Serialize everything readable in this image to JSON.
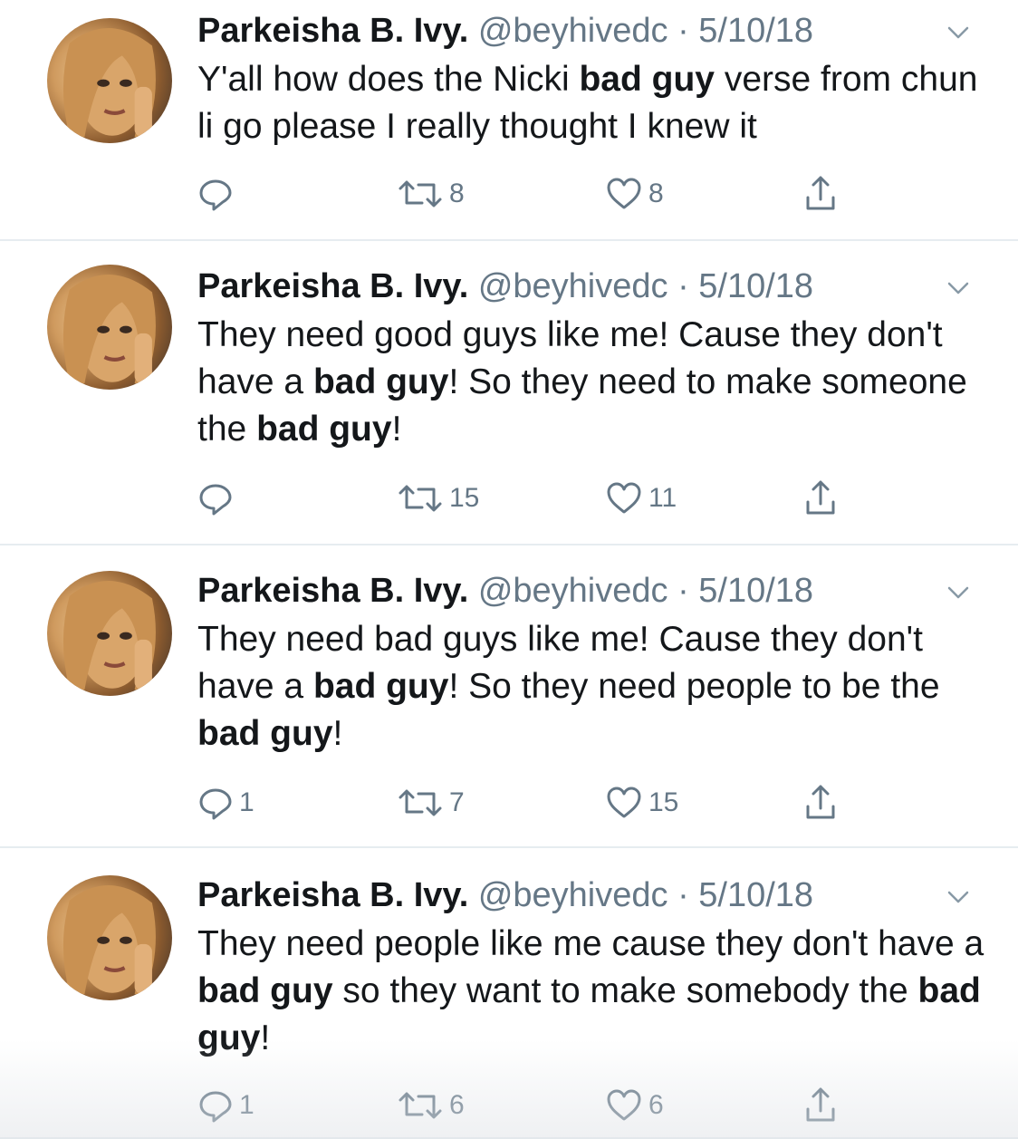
{
  "tweets": [
    {
      "display_name": "Parkeisha B. Ivy.",
      "handle": "@beyhivedc",
      "separator": "·",
      "date": "5/10/18",
      "text_parts": [
        {
          "t": "Y'all how does the Nicki ",
          "bold": false
        },
        {
          "t": "bad guy",
          "bold": true
        },
        {
          "t": " verse from chun li go please I really thought I knew it",
          "bold": false
        }
      ],
      "replies": "",
      "retweets": "8",
      "likes": "8"
    },
    {
      "display_name": "Parkeisha B. Ivy.",
      "handle": "@beyhivedc",
      "separator": "·",
      "date": "5/10/18",
      "text_parts": [
        {
          "t": "They need good guys like me! Cause they don't have a ",
          "bold": false
        },
        {
          "t": "bad guy",
          "bold": true
        },
        {
          "t": "! So they need to make someone the ",
          "bold": false
        },
        {
          "t": "bad guy",
          "bold": true
        },
        {
          "t": "!",
          "bold": false
        }
      ],
      "replies": "",
      "retweets": "15",
      "likes": "11"
    },
    {
      "display_name": "Parkeisha B. Ivy.",
      "handle": "@beyhivedc",
      "separator": "·",
      "date": "5/10/18",
      "text_parts": [
        {
          "t": "They need bad guys like me! Cause they don't have a ",
          "bold": false
        },
        {
          "t": "bad guy",
          "bold": true
        },
        {
          "t": "! So they need people to be the ",
          "bold": false
        },
        {
          "t": "bad guy",
          "bold": true
        },
        {
          "t": "!",
          "bold": false
        }
      ],
      "replies": "1",
      "retweets": "7",
      "likes": "15"
    },
    {
      "display_name": "Parkeisha B. Ivy.",
      "handle": "@beyhivedc",
      "separator": "·",
      "date": "5/10/18",
      "text_parts": [
        {
          "t": "They need people like me cause they don't have a ",
          "bold": false
        },
        {
          "t": "bad guy",
          "bold": true
        },
        {
          "t": " so they want to make somebody the ",
          "bold": false
        },
        {
          "t": "bad guy",
          "bold": true
        },
        {
          "t": "!",
          "bold": false
        }
      ],
      "replies": "1",
      "retweets": "6",
      "likes": "6"
    }
  ],
  "icons": {
    "reply": "reply-icon",
    "retweet": "retweet-icon",
    "like": "heart-icon",
    "share": "share-icon",
    "menu": "chevron-down-icon"
  },
  "colors": {
    "text": "#14171a",
    "muted": "#657786",
    "divider": "#e6ecf0"
  }
}
